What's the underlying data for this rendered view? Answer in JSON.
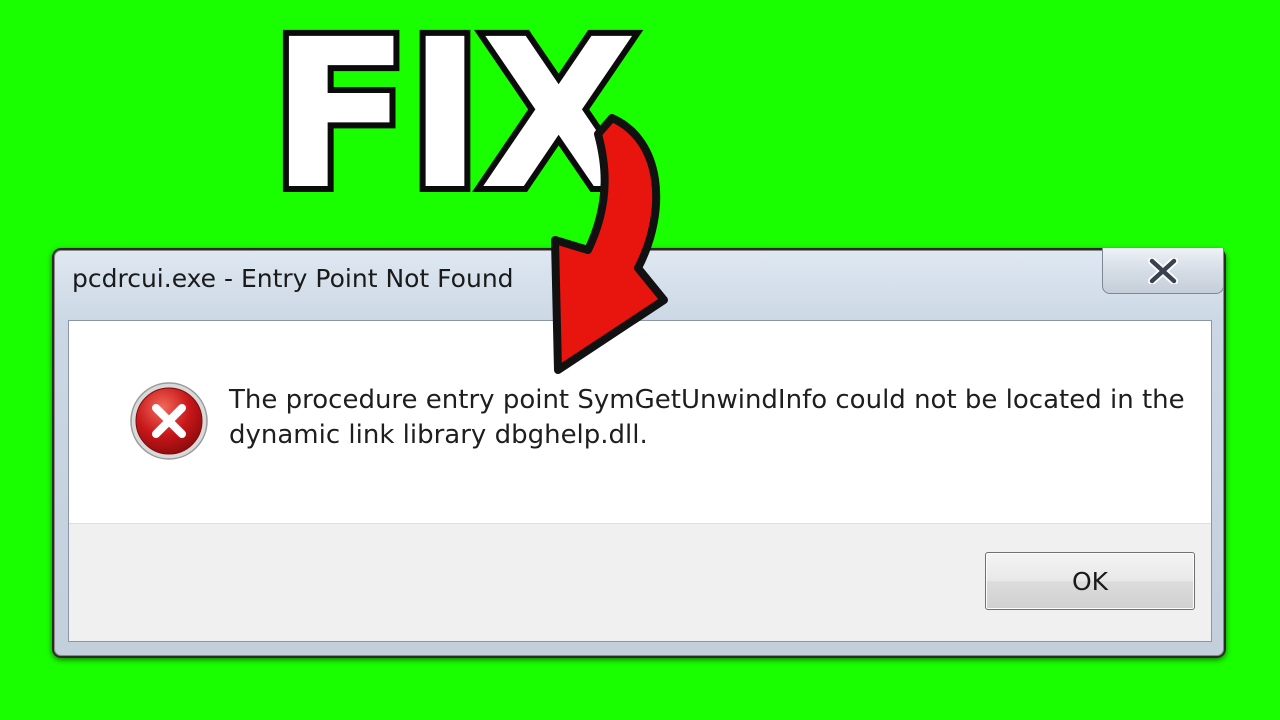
{
  "thumbnail": {
    "headline": "FIX",
    "background_color": "#1aff00",
    "arrow_color": "#e8140e",
    "arrow_icon": "red-curved-arrow-icon"
  },
  "dialog": {
    "title": "pcdrcui.exe - Entry Point Not Found",
    "close_icon": "close-icon",
    "status_icon": "error-icon",
    "message": "The procedure entry point SymGetUnwindInfo could not be located in the dynamic link library dbghelp.dll.",
    "ok_label": "OK"
  }
}
